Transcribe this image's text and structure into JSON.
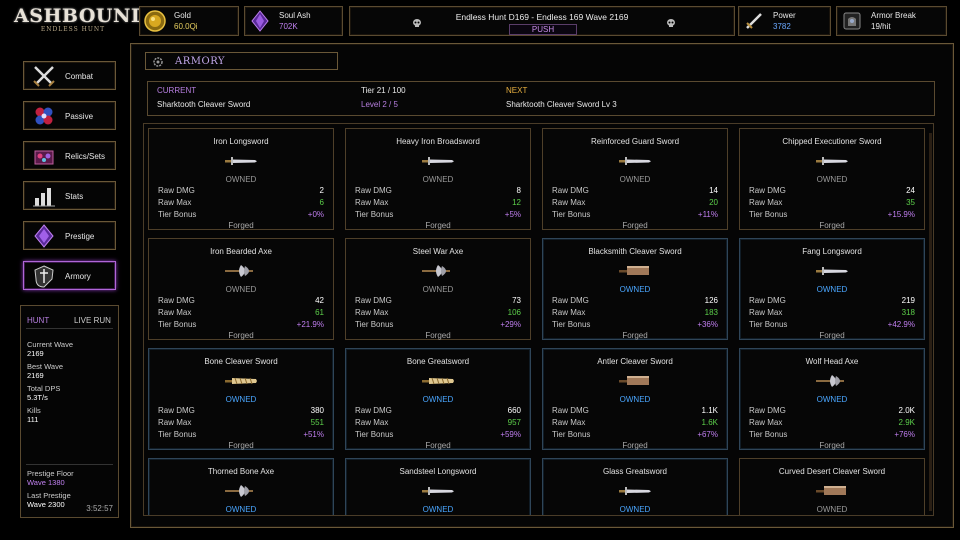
{
  "logo": {
    "title": "ASHBOUND",
    "subtitle": "ENDLESS HUNT"
  },
  "resources": {
    "gold": {
      "label": "Gold",
      "value": "60.0Qi"
    },
    "soul_ash": {
      "label": "Soul Ash",
      "value": "702K"
    },
    "power": {
      "label": "Power",
      "value": "3782"
    },
    "armor_break": {
      "label": "Armor Break",
      "value": "19/hit"
    }
  },
  "hunt": {
    "line": "Endless Hunt  D169  -  Endless 169  Wave 2169",
    "push_label": "PUSH"
  },
  "nav": [
    {
      "label": "Combat",
      "icon": "crossed-swords-icon"
    },
    {
      "label": "Passive",
      "icon": "gem-cluster-icon"
    },
    {
      "label": "Relics/Sets",
      "icon": "relic-chest-icon"
    },
    {
      "label": "Stats",
      "icon": "bar-chart-icon"
    },
    {
      "label": "Prestige",
      "icon": "purple-crystal-icon"
    },
    {
      "label": "Armory",
      "icon": "shield-sword-icon"
    }
  ],
  "stats_panel": {
    "tab_hunt": "HUNT",
    "tab_live": "LIVE RUN",
    "current_wave_label": "Current Wave",
    "current_wave": "2169",
    "best_wave_label": "Best Wave",
    "best_wave": "2169",
    "total_dps_label": "Total DPS",
    "total_dps": "5.3T/s",
    "kills_label": "Kills",
    "kills": "111",
    "prestige_floor_label": "Prestige Floor",
    "prestige_floor": "Wave 1380",
    "last_prestige_label": "Last Prestige",
    "last_prestige": "Wave 2300",
    "clock": "3:52:57"
  },
  "armory": {
    "title": "ARMORY",
    "current_label": "CURRENT",
    "current_value": "Sharktooth Cleaver Sword",
    "tier_value": "Tier 21 / 100",
    "level_value": "Level 2 / 5",
    "next_label": "NEXT",
    "next_value": "Sharktooth Cleaver Sword Lv 3"
  },
  "card_labels": {
    "raw_dmg": "Raw DMG",
    "raw_max": "Raw Max",
    "tier_bonus": "Tier Bonus"
  },
  "weapons": [
    {
      "name": "Iron Longsword",
      "status": "OWNED",
      "dmg": "2",
      "max": "6",
      "bonus": "+0%",
      "footer": "Forged",
      "kind": "sword",
      "equipped": false
    },
    {
      "name": "Heavy Iron Broadsword",
      "status": "OWNED",
      "dmg": "8",
      "max": "12",
      "bonus": "+5%",
      "footer": "Forged",
      "kind": "sword",
      "equipped": false
    },
    {
      "name": "Reinforced Guard Sword",
      "status": "OWNED",
      "dmg": "14",
      "max": "20",
      "bonus": "+11%",
      "footer": "Forged",
      "kind": "sword",
      "equipped": false
    },
    {
      "name": "Chipped Executioner Sword",
      "status": "OWNED",
      "dmg": "24",
      "max": "35",
      "bonus": "+15.9%",
      "footer": "Forged",
      "kind": "sword",
      "equipped": false
    },
    {
      "name": "Iron Bearded Axe",
      "status": "OWNED",
      "dmg": "42",
      "max": "61",
      "bonus": "+21.9%",
      "footer": "Forged",
      "kind": "axe",
      "equipped": false
    },
    {
      "name": "Steel War Axe",
      "status": "OWNED",
      "dmg": "73",
      "max": "106",
      "bonus": "+29%",
      "footer": "Forged",
      "kind": "axe",
      "equipped": false
    },
    {
      "name": "Blacksmith Cleaver Sword",
      "status": "OWNED",
      "dmg": "126",
      "max": "183",
      "bonus": "+36%",
      "footer": "Forged",
      "kind": "cleaver",
      "equipped": true
    },
    {
      "name": "Fang Longsword",
      "status": "OWNED",
      "dmg": "219",
      "max": "318",
      "bonus": "+42.9%",
      "footer": "Forged",
      "kind": "sword",
      "equipped": true
    },
    {
      "name": "Bone Cleaver Sword",
      "status": "OWNED",
      "dmg": "380",
      "max": "551",
      "bonus": "+51%",
      "footer": "Forged",
      "kind": "bone",
      "equipped": true
    },
    {
      "name": "Bone Greatsword",
      "status": "OWNED",
      "dmg": "660",
      "max": "957",
      "bonus": "+59%",
      "footer": "Forged",
      "kind": "bone",
      "equipped": true
    },
    {
      "name": "Antler Cleaver Sword",
      "status": "OWNED",
      "dmg": "1.1K",
      "max": "1.6K",
      "bonus": "+67%",
      "footer": "Forged",
      "kind": "cleaver",
      "equipped": true
    },
    {
      "name": "Wolf Head Axe",
      "status": "OWNED",
      "dmg": "2.0K",
      "max": "2.9K",
      "bonus": "+76%",
      "footer": "Forged",
      "kind": "axe",
      "equipped": true
    },
    {
      "name": "Thorned Bone Axe",
      "status": "OWNED",
      "kind": "axe",
      "equipped": true
    },
    {
      "name": "Sandsteel Longsword",
      "status": "OWNED",
      "kind": "sword",
      "equipped": true
    },
    {
      "name": "Glass Greatsword",
      "status": "OWNED",
      "kind": "sword",
      "equipped": true
    },
    {
      "name": "Curved Desert Cleaver Sword",
      "status": "OWNED",
      "kind": "cleaver",
      "equipped": false
    }
  ],
  "colors": {
    "gold_frame": "#6a5838",
    "purple_accent": "#c080f0",
    "green_stat": "#5ccf4a",
    "blue_owned": "#4aa6ff"
  }
}
